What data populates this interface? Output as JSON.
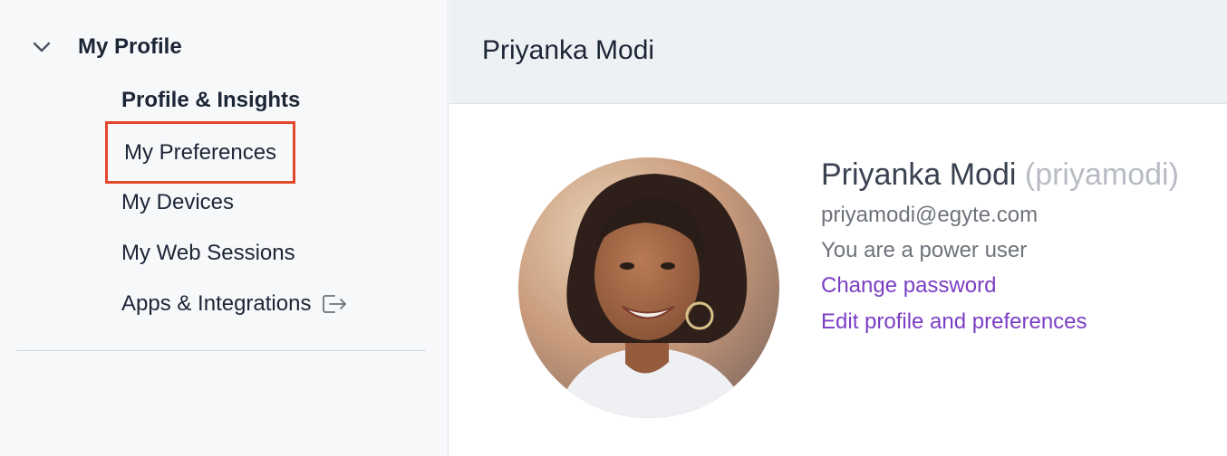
{
  "sidebar": {
    "section_title": "My Profile",
    "items": [
      {
        "label": "Profile & Insights"
      },
      {
        "label": "My Preferences"
      },
      {
        "label": "My Devices"
      },
      {
        "label": "My Web Sessions"
      },
      {
        "label": "Apps & Integrations"
      }
    ]
  },
  "header": {
    "title": "Priyanka Modi"
  },
  "profile": {
    "name": "Priyanka Modi",
    "username": "(priyamodi)",
    "email": "priyamodi@egyte.com",
    "role": "You are a power user",
    "change_password_label": "Change password",
    "edit_profile_label": "Edit profile and preferences"
  },
  "colors": {
    "accent_link": "#7b3fc4",
    "highlight_border": "#e2472b",
    "text_primary": "#1c2536"
  },
  "icons": {
    "section_toggle": "chevron-down-icon",
    "apps_integrations": "external-link-icon"
  }
}
